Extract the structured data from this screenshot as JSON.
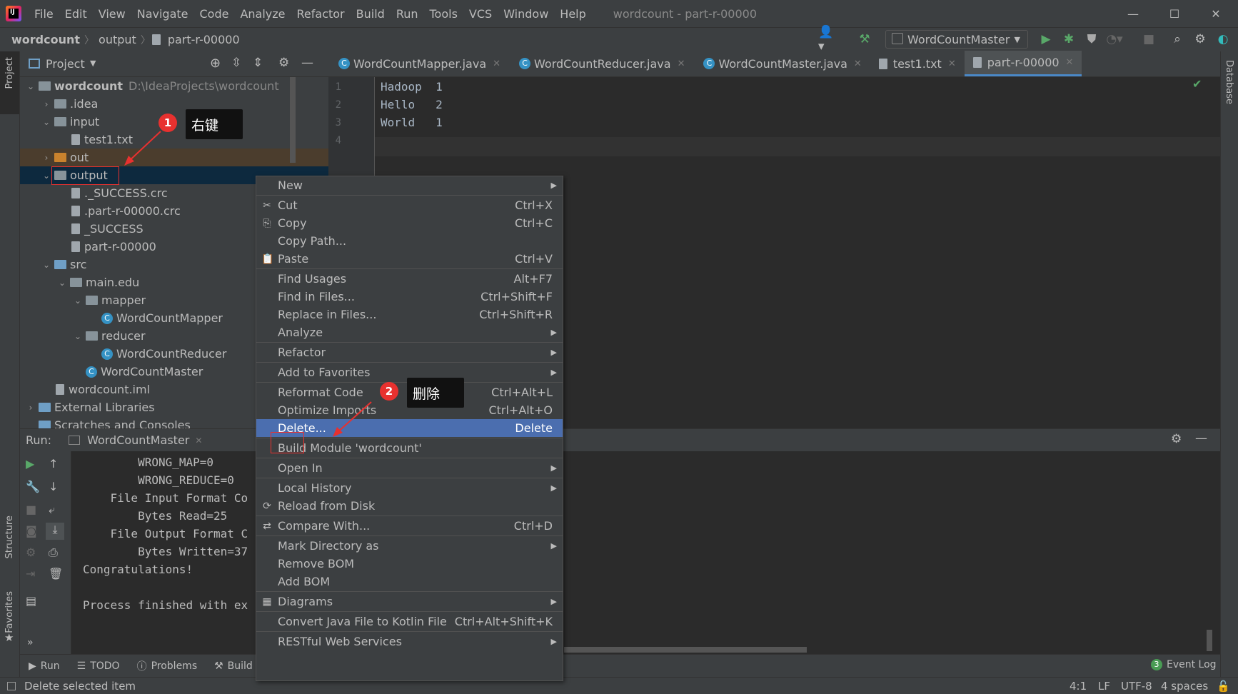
{
  "window": {
    "title": "wordcount - part-r-00000",
    "minimize": "—",
    "maximize": "☐",
    "close": "✕"
  },
  "menu": [
    "File",
    "Edit",
    "View",
    "Navigate",
    "Code",
    "Analyze",
    "Refactor",
    "Build",
    "Run",
    "Tools",
    "VCS",
    "Window",
    "Help"
  ],
  "breadcrumb": [
    "wordcount",
    "output",
    "part-r-00000"
  ],
  "run_config": "WordCountMaster",
  "project_panel": {
    "label": "Project"
  },
  "tree": [
    {
      "label": "wordcount",
      "path": "D:\\IdeaProjects\\wordcount",
      "depth": 0,
      "type": "module"
    },
    {
      "label": ".idea",
      "depth": 1,
      "type": "folder"
    },
    {
      "label": "input",
      "depth": 1,
      "type": "folder"
    },
    {
      "label": "test1.txt",
      "depth": 2,
      "type": "file"
    },
    {
      "label": "out",
      "depth": 1,
      "type": "folder-orange"
    },
    {
      "label": "output",
      "depth": 1,
      "type": "folder"
    },
    {
      "label": "._SUCCESS.crc",
      "depth": 2,
      "type": "file"
    },
    {
      "label": ".part-r-00000.crc",
      "depth": 2,
      "type": "file"
    },
    {
      "label": "_SUCCESS",
      "depth": 2,
      "type": "file"
    },
    {
      "label": "part-r-00000",
      "depth": 2,
      "type": "file"
    },
    {
      "label": "src",
      "depth": 1,
      "type": "folder-blue"
    },
    {
      "label": "main.edu",
      "depth": 2,
      "type": "folder"
    },
    {
      "label": "mapper",
      "depth": 3,
      "type": "folder"
    },
    {
      "label": "WordCountMapper",
      "depth": 4,
      "type": "class"
    },
    {
      "label": "reducer",
      "depth": 3,
      "type": "folder"
    },
    {
      "label": "WordCountReducer",
      "depth": 4,
      "type": "class"
    },
    {
      "label": "WordCountMaster",
      "depth": 3,
      "type": "class"
    },
    {
      "label": "wordcount.iml",
      "depth": 1,
      "type": "file"
    },
    {
      "label": "External Libraries",
      "depth": 0,
      "type": "lib"
    },
    {
      "label": "Scratches and Consoles",
      "depth": 0,
      "type": "lib"
    }
  ],
  "editor_tabs": [
    {
      "label": "WordCountMapper.java",
      "icon": "C"
    },
    {
      "label": "WordCountReducer.java",
      "icon": "C"
    },
    {
      "label": "WordCountMaster.java",
      "icon": "C"
    },
    {
      "label": "test1.txt",
      "icon": "file"
    },
    {
      "label": "part-r-00000",
      "icon": "file",
      "active": true
    }
  ],
  "editor_lines": [
    "1",
    "2",
    "3",
    "4"
  ],
  "editor_code": [
    "Hadoop  1",
    "Hello   2",
    "World   1",
    ""
  ],
  "run_panel": {
    "label": "Run:",
    "tab": "WordCountMaster"
  },
  "console": [
    "        WRONG_MAP=0",
    "        WRONG_REDUCE=0",
    "    File Input Format Co",
    "        Bytes Read=25",
    "    File Output Format C",
    "        Bytes Written=37",
    "Congratulations!",
    "",
    "Process finished with ex"
  ],
  "bottom_tabs": [
    "Run",
    "TODO",
    "Problems",
    "Build"
  ],
  "event_log": {
    "count": "3",
    "label": "Event Log"
  },
  "status": {
    "message": "Delete selected item",
    "position": "4:1",
    "line_sep": "LF",
    "encoding": "UTF-8",
    "indent": "4 spaces"
  },
  "side_labels": {
    "project": "Project",
    "structure": "Structure",
    "favorites": "Favorites",
    "database": "Database"
  },
  "context_menu": [
    {
      "label": "New",
      "submenu": true
    },
    {
      "sep": true
    },
    {
      "label": "Cut",
      "shortcut": "Ctrl+X",
      "icon": "✂"
    },
    {
      "label": "Copy",
      "shortcut": "Ctrl+C",
      "icon": "⎘"
    },
    {
      "label": "Copy Path...",
      "shortcut": ""
    },
    {
      "label": "Paste",
      "shortcut": "Ctrl+V",
      "icon": "📋"
    },
    {
      "sep": true
    },
    {
      "label": "Find Usages",
      "shortcut": "Alt+F7"
    },
    {
      "label": "Find in Files...",
      "shortcut": "Ctrl+Shift+F"
    },
    {
      "label": "Replace in Files...",
      "shortcut": "Ctrl+Shift+R"
    },
    {
      "label": "Analyze",
      "submenu": true
    },
    {
      "sep": true
    },
    {
      "label": "Refactor",
      "submenu": true
    },
    {
      "sep": true
    },
    {
      "label": "Add to Favorites",
      "submenu": true
    },
    {
      "sep": true
    },
    {
      "label": "Reformat Code",
      "shortcut": "Ctrl+Alt+L"
    },
    {
      "label": "Optimize Imports",
      "shortcut": "Ctrl+Alt+O"
    },
    {
      "label": "Delete...",
      "shortcut": "Delete",
      "active": true
    },
    {
      "sep": true
    },
    {
      "label": "Build Module 'wordcount'",
      "shortcut": ""
    },
    {
      "sep": true
    },
    {
      "label": "Open In",
      "submenu": true
    },
    {
      "sep": true
    },
    {
      "label": "Local History",
      "submenu": true
    },
    {
      "label": "Reload from Disk",
      "icon": "⟳"
    },
    {
      "sep": true
    },
    {
      "label": "Compare With...",
      "shortcut": "Ctrl+D",
      "icon": "⇄"
    },
    {
      "sep": true
    },
    {
      "label": "Mark Directory as",
      "submenu": true
    },
    {
      "label": "Remove BOM"
    },
    {
      "label": "Add BOM"
    },
    {
      "sep": true
    },
    {
      "label": "Diagrams",
      "submenu": true,
      "icon": "▦"
    },
    {
      "sep": true
    },
    {
      "label": "Convert Java File to Kotlin File",
      "shortcut": "Ctrl+Alt+Shift+K"
    },
    {
      "sep": true
    },
    {
      "label": "RESTful Web Services",
      "submenu": true
    }
  ],
  "annotations": [
    {
      "number": "1",
      "text": "右键"
    },
    {
      "number": "2",
      "text": "删除"
    }
  ],
  "colors": {
    "accent": "#4b6eaf",
    "annotation": "#e8312f",
    "selection": "#0d293e"
  }
}
